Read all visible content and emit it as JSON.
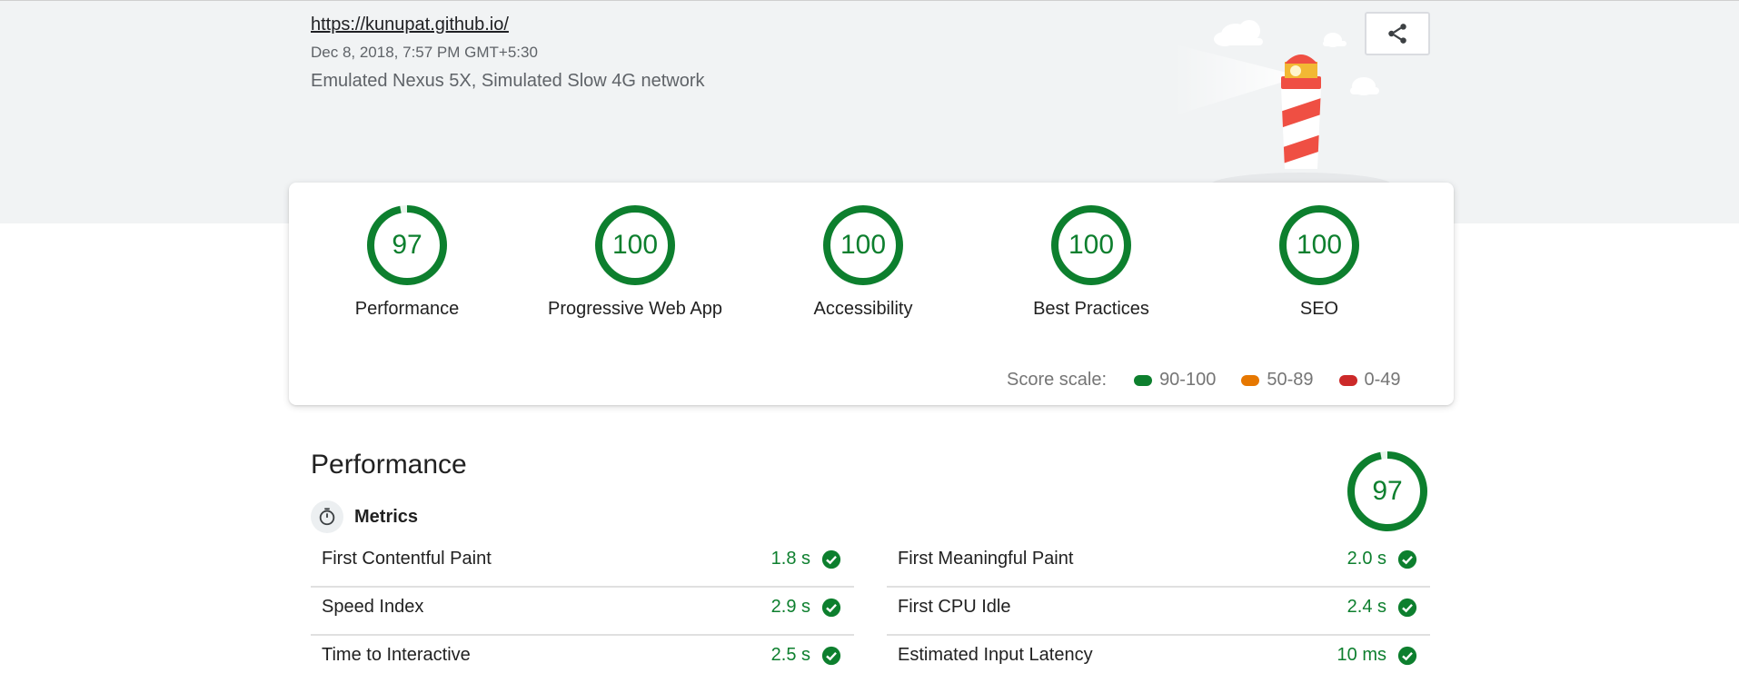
{
  "header": {
    "url": "https://kunupat.github.io/",
    "date": "Dec 8, 2018, 7:57 PM GMT+5:30",
    "environment": "Emulated Nexus 5X, Simulated Slow 4G network"
  },
  "scores": [
    {
      "label": "Performance",
      "value": "97"
    },
    {
      "label": "Progressive Web App",
      "value": "100"
    },
    {
      "label": "Accessibility",
      "value": "100"
    },
    {
      "label": "Best Practices",
      "value": "100"
    },
    {
      "label": "SEO",
      "value": "100"
    }
  ],
  "score_scale": {
    "label": "Score scale:",
    "pass": "90-100",
    "average": "50-89",
    "fail": "0-49"
  },
  "performance": {
    "title": "Performance",
    "score": "97",
    "metrics_label": "Metrics",
    "metrics": [
      {
        "name": "First Contentful Paint",
        "value": "1.8 s"
      },
      {
        "name": "First Meaningful Paint",
        "value": "2.0 s"
      },
      {
        "name": "Speed Index",
        "value": "2.9 s"
      },
      {
        "name": "First CPU Idle",
        "value": "2.4 s"
      },
      {
        "name": "Time to Interactive",
        "value": "2.5 s"
      },
      {
        "name": "Estimated Input Latency",
        "value": "10 ms"
      }
    ]
  },
  "colors": {
    "pass": "#0d7f2e",
    "average": "#e67700",
    "fail": "#cc2929",
    "band": "#f1f3f4"
  },
  "icons": [
    "share-icon",
    "stopwatch-icon",
    "check-circle-icon",
    "lighthouse-illustration"
  ]
}
